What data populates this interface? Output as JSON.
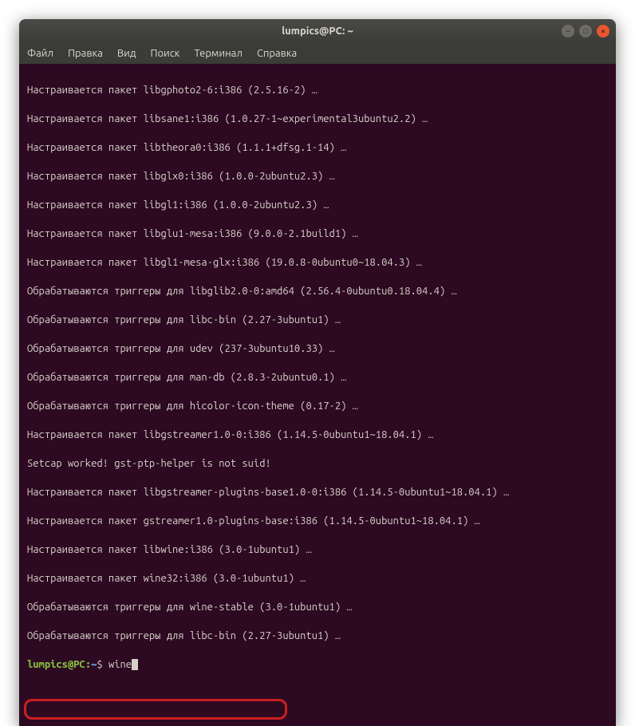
{
  "window": {
    "title": "lumpics@PC: ~"
  },
  "menubar": {
    "items": [
      "Файл",
      "Правка",
      "Вид",
      "Поиск",
      "Терминал",
      "Справка"
    ]
  },
  "terminal": {
    "lines": [
      "Настраивается пакет libgphoto2-6:i386 (2.5.16-2) …",
      "Настраивается пакет libsane1:i386 (1.0.27-1~experimental3ubuntu2.2) …",
      "Настраивается пакет libtheora0:i386 (1.1.1+dfsg.1-14) …",
      "Настраивается пакет libglx0:i386 (1.0.0-2ubuntu2.3) …",
      "Настраивается пакет libgl1:i386 (1.0.0-2ubuntu2.3) …",
      "Настраивается пакет libglu1-mesa:i386 (9.0.0-2.1build1) …",
      "Настраивается пакет libgl1-mesa-glx:i386 (19.0.8-0ubuntu0~18.04.3) …",
      "Обрабатываются триггеры для libglib2.0-0:amd64 (2.56.4-0ubuntu0.18.04.4) …",
      "Обрабатываются триггеры для libc-bin (2.27-3ubuntu1) …",
      "Обрабатываются триггеры для udev (237-3ubuntu10.33) …",
      "Обрабатываются триггеры для man-db (2.8.3-2ubuntu0.1) …",
      "Обрабатываются триггеры для hicolor-icon-theme (0.17-2) …",
      "Настраивается пакет libgstreamer1.0-0:i386 (1.14.5-0ubuntu1~18.04.1) …",
      "Setcap worked! gst-ptp-helper is not suid!",
      "Настраивается пакет libgstreamer-plugins-base1.0-0:i386 (1.14.5-0ubuntu1~18.04.1) …",
      "Настраивается пакет gstreamer1.0-plugins-base:i386 (1.14.5-0ubuntu1~18.04.1) …",
      "Настраивается пакет libwine:i386 (3.0-1ubuntu1) …",
      "Настраивается пакет wine32:i386 (3.0-1ubuntu1) …",
      "Обрабатываются триггеры для wine-stable (3.0-1ubuntu1) …",
      "Обрабатываются триггеры для libc-bin (2.27-3ubuntu1) …"
    ],
    "prompt": {
      "userhost": "lumpics@PC",
      "colon": ":",
      "path": "~",
      "dollar": "$",
      "command": "wine"
    }
  }
}
